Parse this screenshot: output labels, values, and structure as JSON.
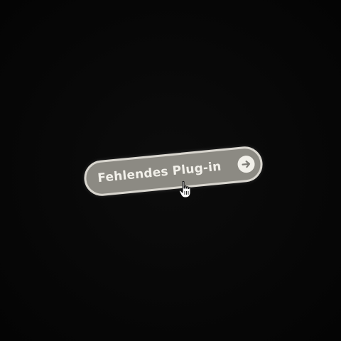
{
  "plugin_prompt": {
    "label": "Fehlendes Plug-in",
    "arrow_icon": "arrow-right-circle-icon"
  },
  "cursor": {
    "icon": "hand-pointer-cursor-icon"
  },
  "colors": {
    "background": "#060606",
    "pill_fill": "#8c8a83",
    "pill_border": "#d9d6cf",
    "label_text": "#f2f0ea"
  }
}
